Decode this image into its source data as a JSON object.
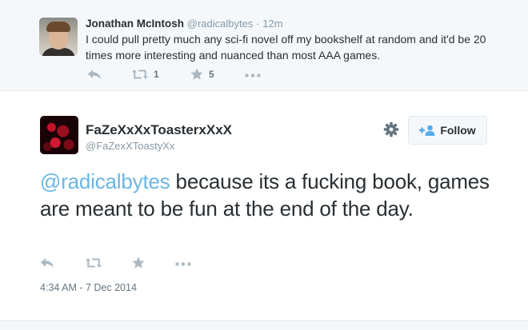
{
  "parent_tweet": {
    "author_name": "Jonathan McIntosh",
    "author_handle": "@radicalbytes",
    "separator": "·",
    "time_ago": "12m",
    "text": "I could pull pretty much any sci-fi novel off my bookshelf at random and it'd be 20 times more interesting and nuanced than most AAA games.",
    "retweet_count": "1",
    "favorite_count": "5",
    "icons": [
      "reply-icon",
      "retweet-icon",
      "favorite-icon",
      "more-icon"
    ]
  },
  "main_tweet": {
    "author_name": "FaZeXxXxToasterxXxX",
    "author_handle": "@FaZexXToastyXx",
    "follow_label": "Follow",
    "mention": "@radicalbytes",
    "text": " because its a fucking book, games are meant to be fun at the end of the day.",
    "timestamp": "4:34 AM - 7 Dec 2014",
    "icons": [
      "gear-icon",
      "follow-person-icon",
      "reply-icon",
      "retweet-icon",
      "favorite-icon",
      "more-icon"
    ]
  },
  "colors": {
    "background": "#f5f8fa",
    "card": "#ffffff",
    "mention": "#6ab6e4",
    "muted": "#8899a6",
    "icon": "#aab8c2",
    "text": "#292f33"
  }
}
